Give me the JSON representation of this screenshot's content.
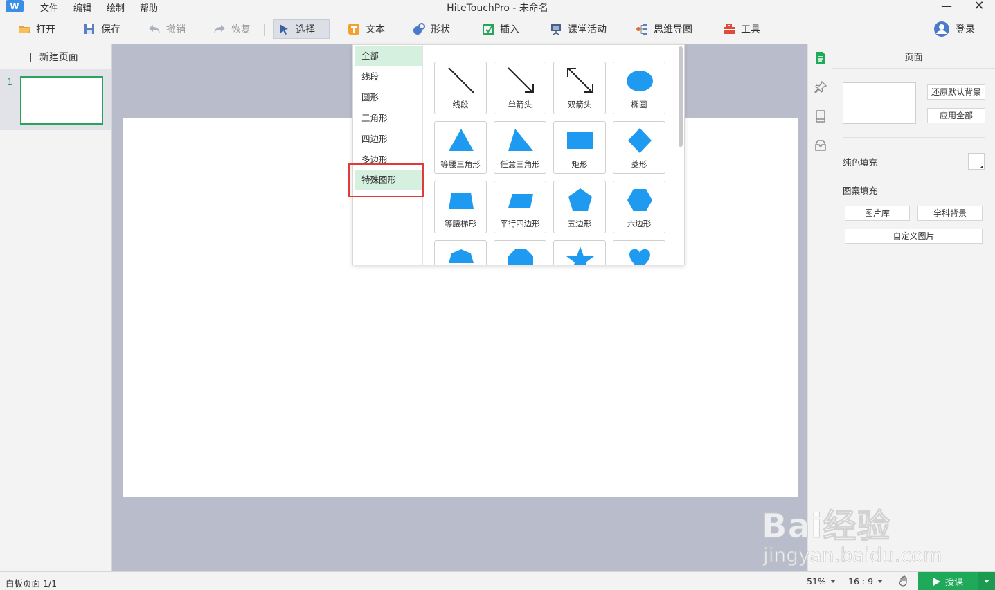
{
  "window": {
    "title": "HiteTouchPro - 未命名",
    "logo_letter": "W",
    "menu": [
      "文件",
      "编辑",
      "绘制",
      "帮助"
    ],
    "minimize": "—",
    "close": "✕"
  },
  "toolbar": {
    "open": "打开",
    "save": "保存",
    "undo": "撤销",
    "redo": "恢复",
    "select": "选择",
    "text": "文本",
    "shape": "形状",
    "insert": "插入",
    "class_activity": "课堂活动",
    "mindmap": "思维导图",
    "tools": "工具",
    "login": "登录"
  },
  "pages_panel": {
    "new_page": "新建页面",
    "pages": [
      {
        "number": "1"
      }
    ]
  },
  "shape_panel": {
    "categories": [
      "全部",
      "线段",
      "圆形",
      "三角形",
      "四边形",
      "多边形",
      "特殊图形"
    ],
    "selected_category": "全部",
    "highlighted_category": "特殊图形",
    "shapes": [
      "线段",
      "单箭头",
      "双箭头",
      "椭圆",
      "等腰三角形",
      "任意三角形",
      "矩形",
      "菱形",
      "等腰梯形",
      "平行四边形",
      "五边形",
      "六边形"
    ],
    "shape_color": "#1e9bf0"
  },
  "right_panel": {
    "title": "页面",
    "reset_bg": "还原默认背景",
    "apply_all": "应用全部",
    "solid_fill": "纯色填充",
    "pattern_fill": "图案填充",
    "image_lib": "图片库",
    "subject_bg": "学科背景",
    "custom_image": "自定义图片"
  },
  "status": {
    "page_info": "白板页面 1/1",
    "zoom": "51%",
    "ratio": "16 : 9",
    "lesson": "授课"
  },
  "watermark": {
    "brand": "Bai经验",
    "url": "jingyan.baidu.com"
  },
  "colors": {
    "accent_green": "#1faa59",
    "highlight_red": "#e03a3a",
    "selected_bg": "#d6f0e0"
  }
}
